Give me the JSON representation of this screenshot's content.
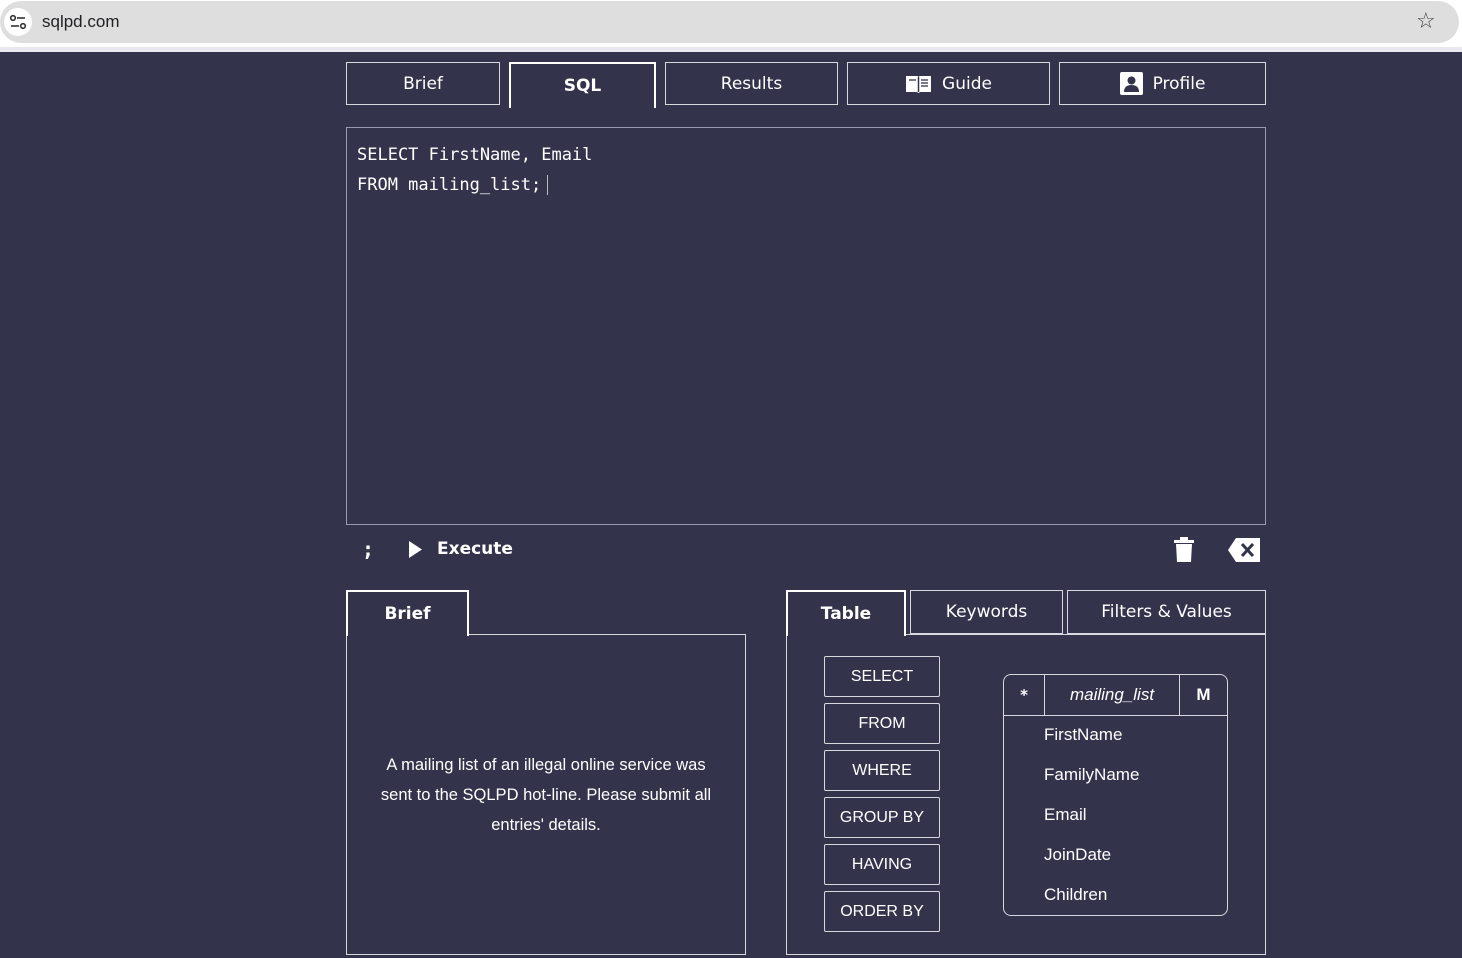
{
  "browser": {
    "url": "sqlpd.com"
  },
  "tabs": {
    "brief": "Brief",
    "sql": "SQL",
    "results": "Results",
    "guide": "Guide",
    "profile": "Profile"
  },
  "editor": {
    "line1": "SELECT FirstName, Email",
    "line2": "FROM mailing_list;"
  },
  "toolbar": {
    "semicolon": ";",
    "execute": "Execute"
  },
  "brief_panel": {
    "tab": "Brief",
    "text": "A mailing list of an illegal online service was sent to the SQLPD hot-line. Please submit all entries' details."
  },
  "right_panel": {
    "tabs": {
      "table": "Table",
      "keywords": "Keywords",
      "filters": "Filters & Values"
    },
    "keywords": [
      "SELECT",
      "FROM",
      "WHERE",
      "GROUP BY",
      "HAVING",
      "ORDER BY"
    ],
    "schema": {
      "star": "*",
      "table_name": "mailing_list",
      "m": "M",
      "columns": [
        "FirstName",
        "FamilyName",
        "Email",
        "JoinDate",
        "Children"
      ]
    }
  }
}
